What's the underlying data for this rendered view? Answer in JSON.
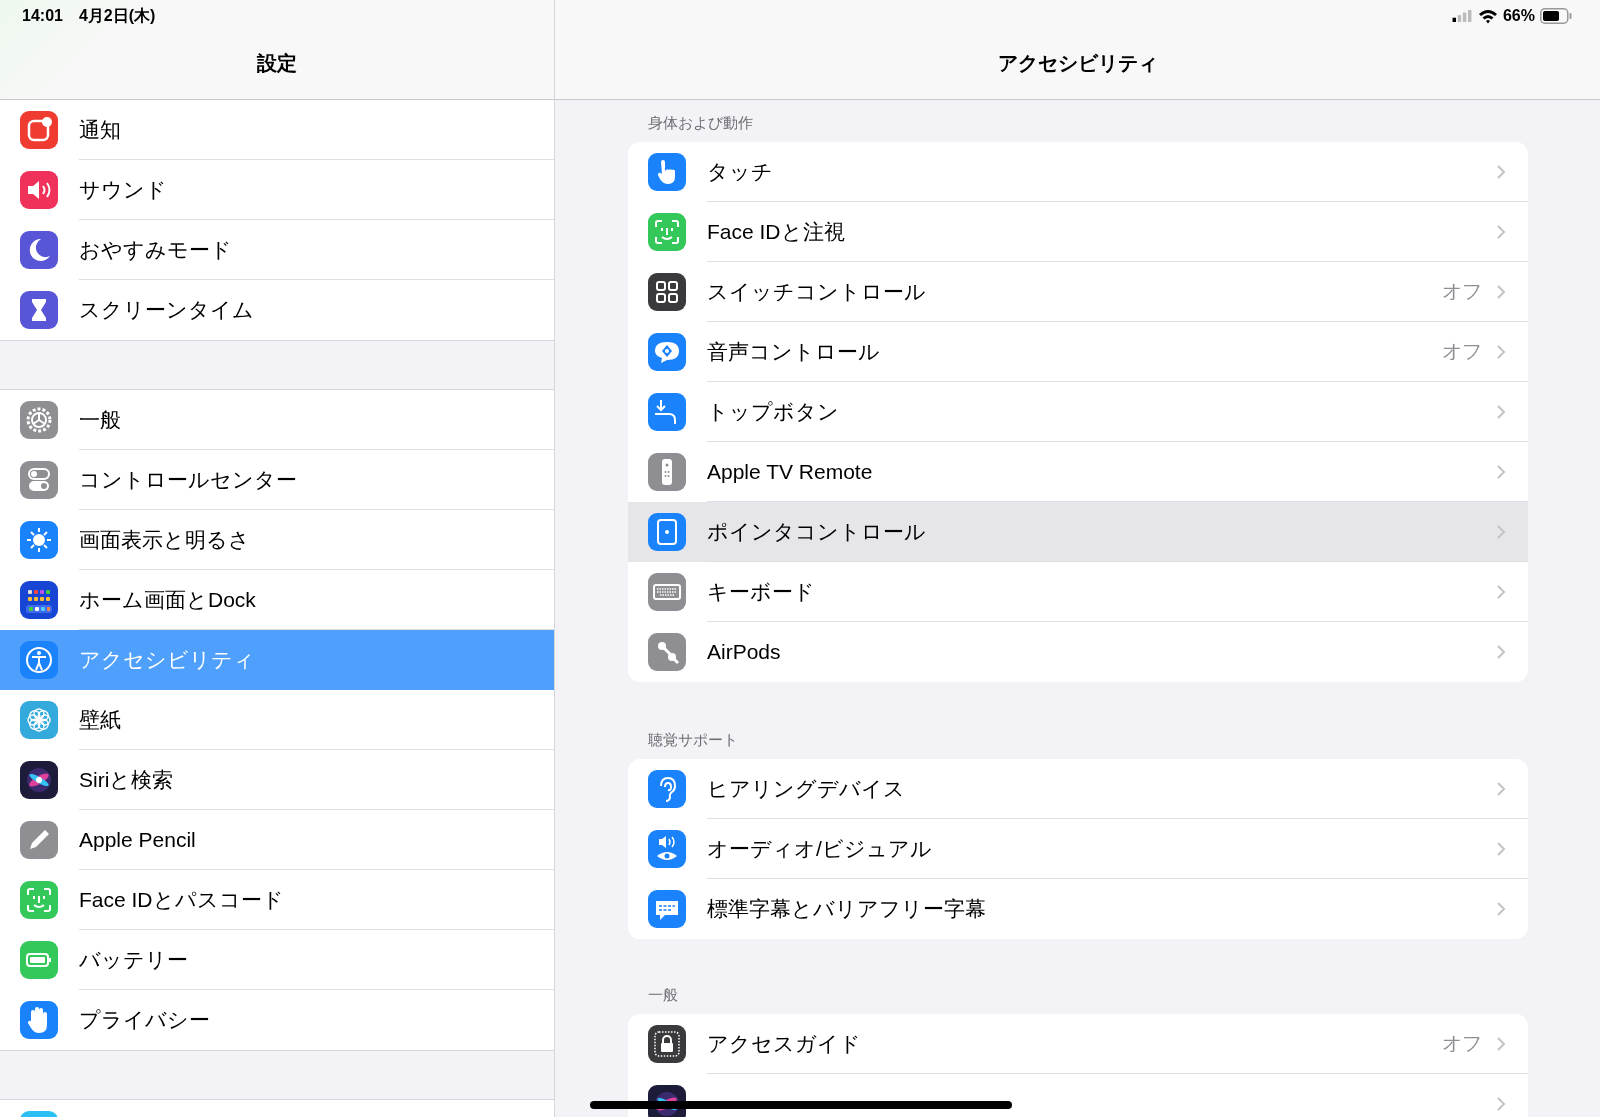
{
  "status_bar": {
    "time": "14:01",
    "date": "4月2日(木)",
    "battery": "66%"
  },
  "sidebar": {
    "title": "設定",
    "groups": [
      {
        "items": [
          {
            "label": "通知",
            "selected": false
          },
          {
            "label": "サウンド",
            "selected": false
          },
          {
            "label": "おやすみモード",
            "selected": false
          },
          {
            "label": "スクリーンタイム",
            "selected": false
          }
        ]
      },
      {
        "items": [
          {
            "label": "一般",
            "selected": false
          },
          {
            "label": "コントロールセンター",
            "selected": false
          },
          {
            "label": "画面表示と明るさ",
            "selected": false
          },
          {
            "label": "ホーム画面とDock",
            "selected": false
          },
          {
            "label": "アクセシビリティ",
            "selected": true
          },
          {
            "label": "壁紙",
            "selected": false
          },
          {
            "label": "Siriと検索",
            "selected": false
          },
          {
            "label": "Apple Pencil",
            "selected": false
          },
          {
            "label": "Face IDとパスコード",
            "selected": false
          },
          {
            "label": "バッテリー",
            "selected": false
          },
          {
            "label": "プライバシー",
            "selected": false
          }
        ]
      }
    ]
  },
  "detail": {
    "title": "アクセシビリティ",
    "sections": [
      {
        "header": "身体および動作",
        "rows": [
          {
            "label": "タッチ",
            "selected": false
          },
          {
            "label": "Face IDと注視",
            "selected": false
          },
          {
            "label": "スイッチコントロール",
            "value": "オフ",
            "selected": false
          },
          {
            "label": "音声コントロール",
            "value": "オフ",
            "selected": false
          },
          {
            "label": "トップボタン",
            "selected": false
          },
          {
            "label": "Apple TV Remote",
            "selected": false
          },
          {
            "label": "ポインタコントロール",
            "selected": true
          },
          {
            "label": "キーボード",
            "selected": false
          },
          {
            "label": "AirPods",
            "selected": false
          }
        ]
      },
      {
        "header": "聴覚サポート",
        "rows": [
          {
            "label": "ヒアリングデバイス",
            "selected": false
          },
          {
            "label": "オーディオ/ビジュアル",
            "selected": false
          },
          {
            "label": "標準字幕とバリアフリー字幕",
            "selected": false
          }
        ]
      },
      {
        "header": "一般",
        "rows": [
          {
            "label": "アクセスガイド",
            "value": "オフ",
            "selected": false
          },
          {
            "selected": false
          }
        ]
      }
    ]
  }
}
